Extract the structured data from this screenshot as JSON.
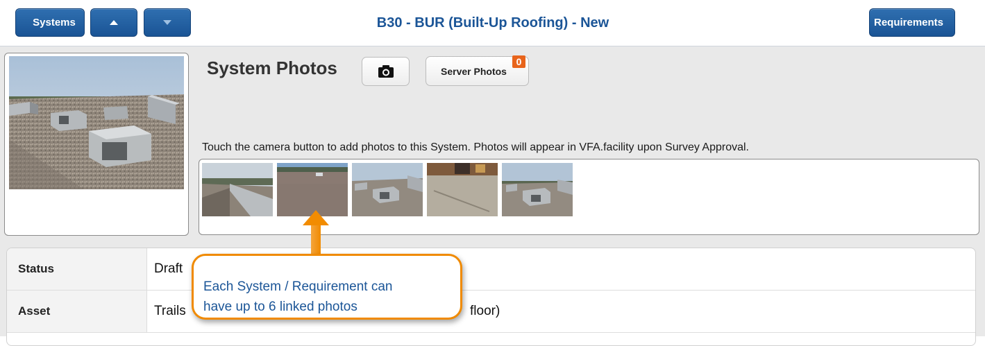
{
  "header": {
    "back_label": "Systems",
    "title": "B30 - BUR (Built-Up Roofing) - New",
    "forward_label": "Requirements"
  },
  "photos": {
    "section_title": "System Photos",
    "camera_icon": "camera-icon",
    "server_photos_label": "Server Photos",
    "server_photos_count": "0",
    "instruction": "Touch the camera button to add photos to this System. Photos will appear in VFA.facility upon Survey Approval.",
    "thumbnail_count": 5
  },
  "details": {
    "rows": [
      {
        "label": "Status",
        "value": "Draft"
      },
      {
        "label": "Asset",
        "value": "Trails",
        "value_tail": "floor)"
      }
    ]
  },
  "callout": {
    "line1": "Each System / Requirement can",
    "line2": "have up to 6 linked photos"
  },
  "colors": {
    "nav_blue": "#1b5597",
    "accent_orange": "#f08a00",
    "badge_orange": "#e8641b"
  }
}
